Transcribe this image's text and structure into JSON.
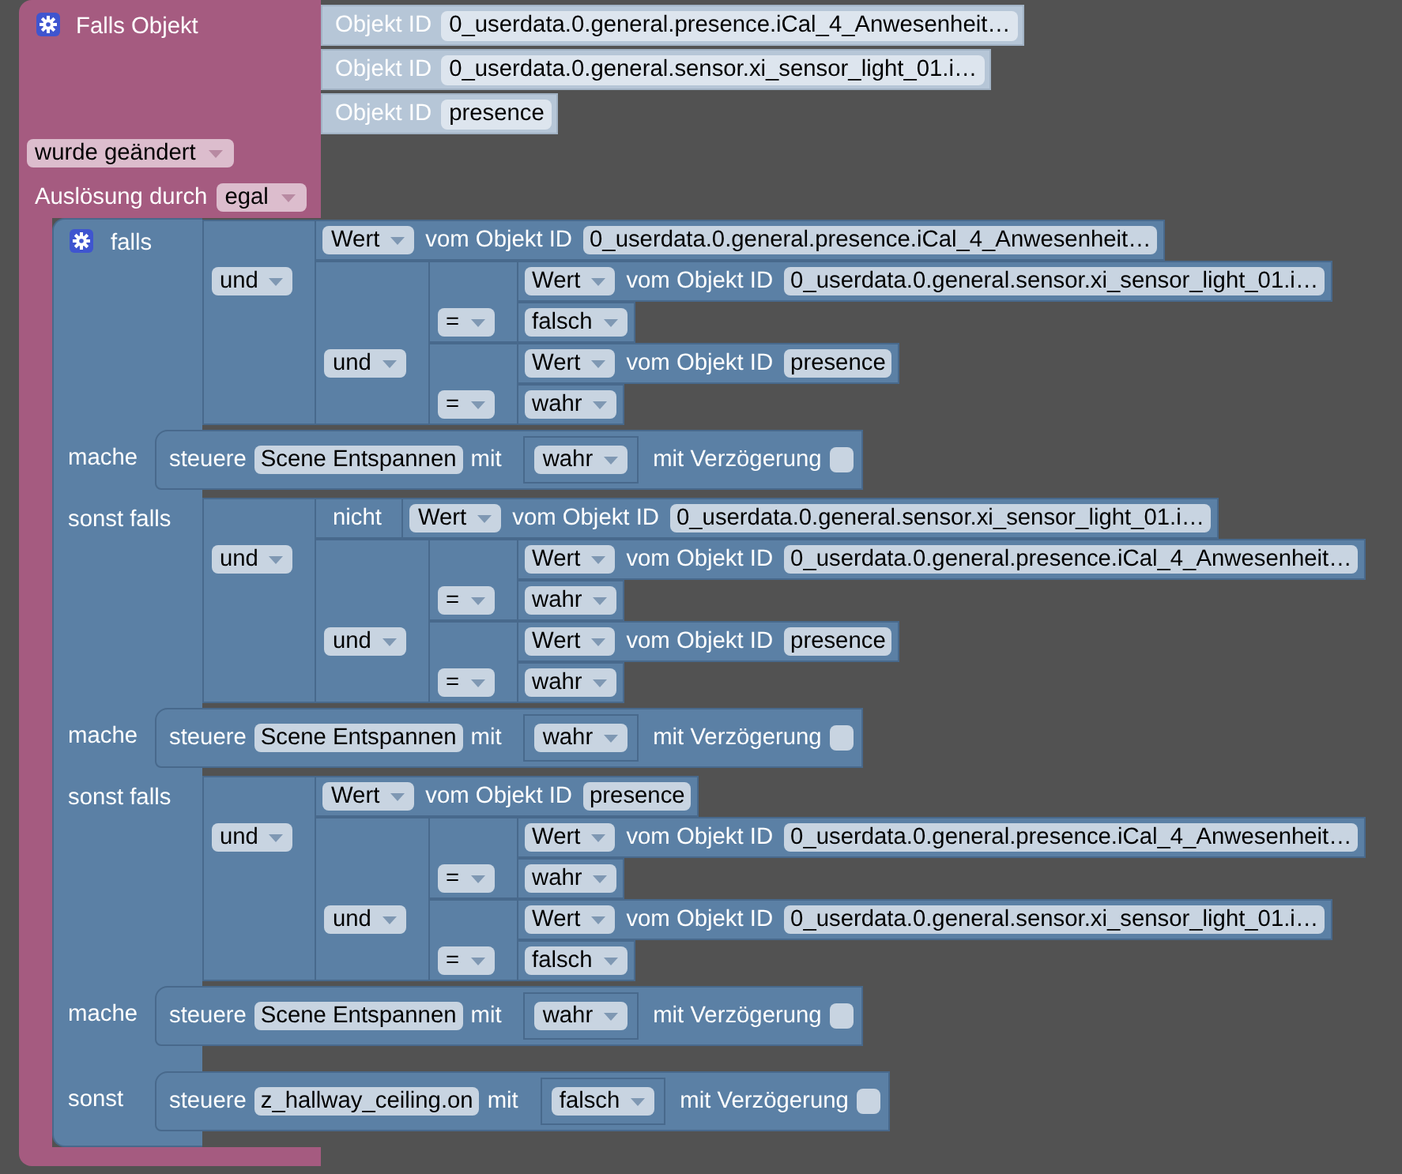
{
  "trigger_block": {
    "title": "Falls Objekt",
    "object_ids": [
      {
        "label": "Objekt ID",
        "value": "0_userdata.0.general.presence.iCal_4_Anwesenheit…"
      },
      {
        "label": "Objekt ID",
        "value": "0_userdata.0.general.sensor.xi_sensor_light_01.i…"
      },
      {
        "label": "Objekt ID",
        "value": "presence"
      }
    ],
    "event": "wurde geändert",
    "trigger_label": "Auslösung durch",
    "trigger": "egal",
    "if_block": {
      "clauses": [
        {
          "label": "falls",
          "condition": {
            "kind": "logic",
            "operator": "und",
            "a": {
              "kind": "get_value",
              "attribute": "Wert",
              "label": "vom Objekt ID",
              "object_id": "0_userdata.0.general.presence.iCal_4_Anwesenheit…"
            },
            "b": {
              "kind": "logic",
              "operator": "und",
              "a": {
                "kind": "compare",
                "operator": "=",
                "a": {
                  "kind": "get_value",
                  "attribute": "Wert",
                  "label": "vom Objekt ID",
                  "object_id": "0_userdata.0.general.sensor.xi_sensor_light_01.i…"
                },
                "b": {
                  "kind": "boolean",
                  "value": "falsch"
                }
              },
              "b": {
                "kind": "compare",
                "operator": "=",
                "a": {
                  "kind": "get_value",
                  "attribute": "Wert",
                  "label": "vom Objekt ID",
                  "object_id": "presence"
                },
                "b": {
                  "kind": "boolean",
                  "value": "wahr"
                }
              }
            }
          },
          "do_label": "mache",
          "do": {
            "kind": "control",
            "label": "steuere",
            "target": "Scene Entspannen",
            "with_label": "mit",
            "value": {
              "kind": "boolean",
              "value": "wahr"
            },
            "delay_label": "mit Verzögerung",
            "delay_checked": false
          }
        },
        {
          "label": "sonst falls",
          "condition": {
            "kind": "logic",
            "operator": "und",
            "a": {
              "kind": "not",
              "label": "nicht",
              "input": {
                "kind": "get_value",
                "attribute": "Wert",
                "label": "vom Objekt ID",
                "object_id": "0_userdata.0.general.sensor.xi_sensor_light_01.i…"
              }
            },
            "b": {
              "kind": "logic",
              "operator": "und",
              "a": {
                "kind": "compare",
                "operator": "=",
                "a": {
                  "kind": "get_value",
                  "attribute": "Wert",
                  "label": "vom Objekt ID",
                  "object_id": "0_userdata.0.general.presence.iCal_4_Anwesenheit…"
                },
                "b": {
                  "kind": "boolean",
                  "value": "wahr"
                }
              },
              "b": {
                "kind": "compare",
                "operator": "=",
                "a": {
                  "kind": "get_value",
                  "attribute": "Wert",
                  "label": "vom Objekt ID",
                  "object_id": "presence"
                },
                "b": {
                  "kind": "boolean",
                  "value": "wahr"
                }
              }
            }
          },
          "do_label": "mache",
          "do": {
            "kind": "control",
            "label": "steuere",
            "target": "Scene Entspannen",
            "with_label": "mit",
            "value": {
              "kind": "boolean",
              "value": "wahr"
            },
            "delay_label": "mit Verzögerung",
            "delay_checked": false
          }
        },
        {
          "label": "sonst falls",
          "condition": {
            "kind": "logic",
            "operator": "und",
            "a": {
              "kind": "get_value",
              "attribute": "Wert",
              "label": "vom Objekt ID",
              "object_id": "presence"
            },
            "b": {
              "kind": "logic",
              "operator": "und",
              "a": {
                "kind": "compare",
                "operator": "=",
                "a": {
                  "kind": "get_value",
                  "attribute": "Wert",
                  "label": "vom Objekt ID",
                  "object_id": "0_userdata.0.general.presence.iCal_4_Anwesenheit…"
                },
                "b": {
                  "kind": "boolean",
                  "value": "wahr"
                }
              },
              "b": {
                "kind": "compare",
                "operator": "=",
                "a": {
                  "kind": "get_value",
                  "attribute": "Wert",
                  "label": "vom Objekt ID",
                  "object_id": "0_userdata.0.general.sensor.xi_sensor_light_01.i…"
                },
                "b": {
                  "kind": "boolean",
                  "value": "falsch"
                }
              }
            }
          },
          "do_label": "mache",
          "do": {
            "kind": "control",
            "label": "steuere",
            "target": "Scene Entspannen",
            "with_label": "mit",
            "value": {
              "kind": "boolean",
              "value": "wahr"
            },
            "delay_label": "mit Verzögerung",
            "delay_checked": false
          }
        }
      ],
      "else_label": "sonst",
      "else_do": {
        "kind": "control",
        "label": "steuere",
        "target": "z_hallway_ceiling.on",
        "with_label": "mit",
        "value": {
          "kind": "boolean",
          "value": "falsch"
        },
        "delay_label": "mit Verzögerung",
        "delay_checked": false
      }
    }
  }
}
